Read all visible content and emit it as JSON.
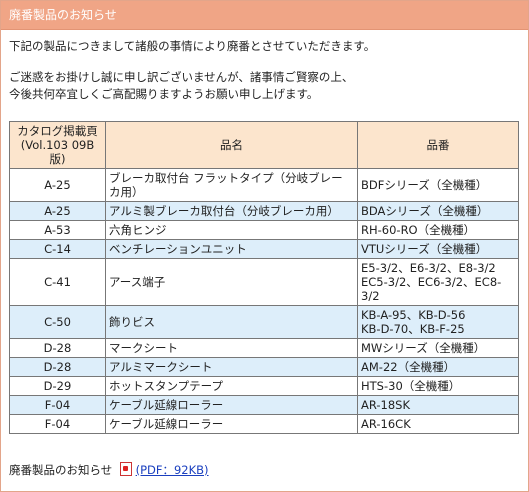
{
  "header": {
    "title": "廃番製品のお知らせ"
  },
  "intro": {
    "line1": "下記の製品につきまして諸般の事情により廃番とさせていただきます。",
    "line2": "ご迷惑をお掛けし誠に申し訳ございませんが、諸事情ご賢察の上、",
    "line3": "今後共何卒宜しくご高配賜りますようお願い申し上げます。"
  },
  "table": {
    "headers": {
      "page_line1": "カタログ掲載頁",
      "page_line2": "(Vol.103 09B版)",
      "name": "品名",
      "number": "品番"
    },
    "rows": [
      {
        "page": "A-25",
        "name": "ブレーカ取付台 フラットタイプ（分岐ブレーカ用）",
        "number": "BDFシリーズ（全機種）"
      },
      {
        "page": "A-25",
        "name": "アルミ製ブレーカ取付台（分岐ブレーカ用）",
        "number": "BDAシリーズ（全機種）"
      },
      {
        "page": "A-53",
        "name": "六角ヒンジ",
        "number": "RH-60-RO（全機種）"
      },
      {
        "page": "C-14",
        "name": "ベンチレーションユニット",
        "number": "VTUシリーズ（全機種）"
      },
      {
        "page": "C-41",
        "name": "アース端子",
        "number": "E5-3/2、E6-3/2、E8-3/2\nEC5-3/2、EC6-3/2、EC8-3/2"
      },
      {
        "page": "C-50",
        "name": "飾りビス",
        "number": "KB-A-95、KB-D-56\nKB-D-70、KB-F-25"
      },
      {
        "page": "D-28",
        "name": "マークシート",
        "number": "MWシリーズ（全機種）"
      },
      {
        "page": "D-28",
        "name": "アルミマークシート",
        "number": "AM-22（全機種）"
      },
      {
        "page": "D-29",
        "name": "ホットスタンプテープ",
        "number": "HTS-30（全機種）"
      },
      {
        "page": "F-04",
        "name": "ケーブル延線ローラー",
        "number": "AR-18SK"
      },
      {
        "page": "F-04",
        "name": "ケーブル延線ローラー",
        "number": "AR-16CK"
      }
    ]
  },
  "footer": {
    "label": "廃番製品のお知らせ",
    "icon": "pdf-icon",
    "link_text": "(PDF：92KB)"
  }
}
